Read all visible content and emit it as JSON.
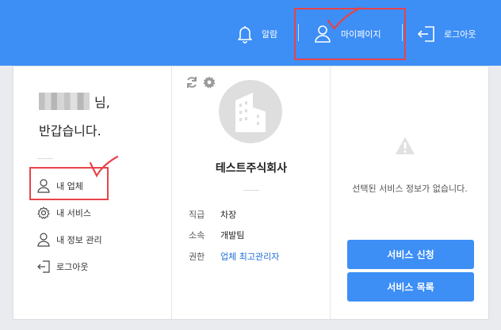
{
  "header": {
    "alarm_label": "알람",
    "mypage_label": "마이페이지",
    "logout_label": "로그아웃"
  },
  "profile": {
    "name_suffix": "님,",
    "greeting": "반갑습니다."
  },
  "menu": {
    "my_company": "내 업체",
    "my_services": "내 서비스",
    "my_info": "내 정보 관리",
    "logout": "로그아웃"
  },
  "company": {
    "name": "테스트주식회사",
    "rows": [
      {
        "label": "직급",
        "value": "차장"
      },
      {
        "label": "소속",
        "value": "개발팀"
      },
      {
        "label": "권한",
        "value": "업체 최고관리자"
      }
    ]
  },
  "services": {
    "empty_message": "선택된 서비스 정보가 없습니다.",
    "apply_button": "서비스 신청",
    "list_button": "서비스 목록"
  },
  "colors": {
    "brand_blue": "#3d8ef5",
    "highlight_red": "#e8434b",
    "link_blue": "#1e6fd9"
  },
  "icons": {
    "alarm": "bell-icon",
    "mypage": "user-icon",
    "logout": "logout-icon",
    "refresh": "refresh-icon",
    "settings": "gear-icon",
    "warning": "warning-icon"
  }
}
